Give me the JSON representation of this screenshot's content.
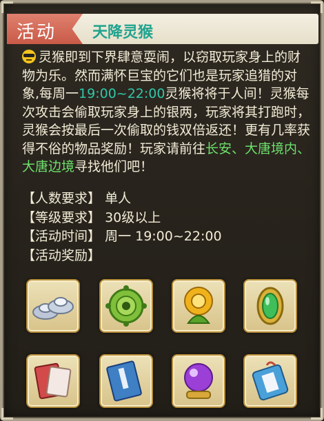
{
  "header": {
    "tag": "活动",
    "title": "天降灵猴"
  },
  "description": {
    "icon": "sunglasses-emoji-icon",
    "part1": "灵猴即到下界肆意耍闹，以窃取玩家身上的财物为乐。然而满怀巨宝的它们也是玩家追猎的对象,每周一",
    "time": "19:00~22:00",
    "part2": "灵猴将将于人间！灵猴每次攻击会偷取玩家身上的银两，玩家将其打跑时，灵猴会按最后一次偷取的钱双倍返还！更有几率获得不俗的物品奖励！玩家请前往",
    "locations": "长安、大唐境内、大唐边境",
    "part3": "寻找他们吧！"
  },
  "requirements": [
    {
      "label": "【人数要求】",
      "value": "单人"
    },
    {
      "label": "【等级要求】",
      "value": "30级以上"
    },
    {
      "label": "【活动时间】",
      "value": "周一 19:00~22:00"
    },
    {
      "label": "【活动奖励】",
      "value": ""
    }
  ],
  "rewards": [
    {
      "icon": "silver-ingots-icon"
    },
    {
      "icon": "green-gear-orb-icon"
    },
    {
      "icon": "golden-flower-icon"
    },
    {
      "icon": "green-jade-gem-icon"
    },
    {
      "icon": "red-scroll-book-icon"
    },
    {
      "icon": "blue-book-icon"
    },
    {
      "icon": "purple-crystal-ball-icon"
    },
    {
      "icon": "blue-talisman-bag-icon"
    }
  ],
  "colors": {
    "tag_bg": "#d0604e",
    "title": "#1fa38e",
    "time_highlight": "#2fc7a8",
    "location_highlight": "#6ee06c",
    "body_text": "#f2ecd6"
  }
}
